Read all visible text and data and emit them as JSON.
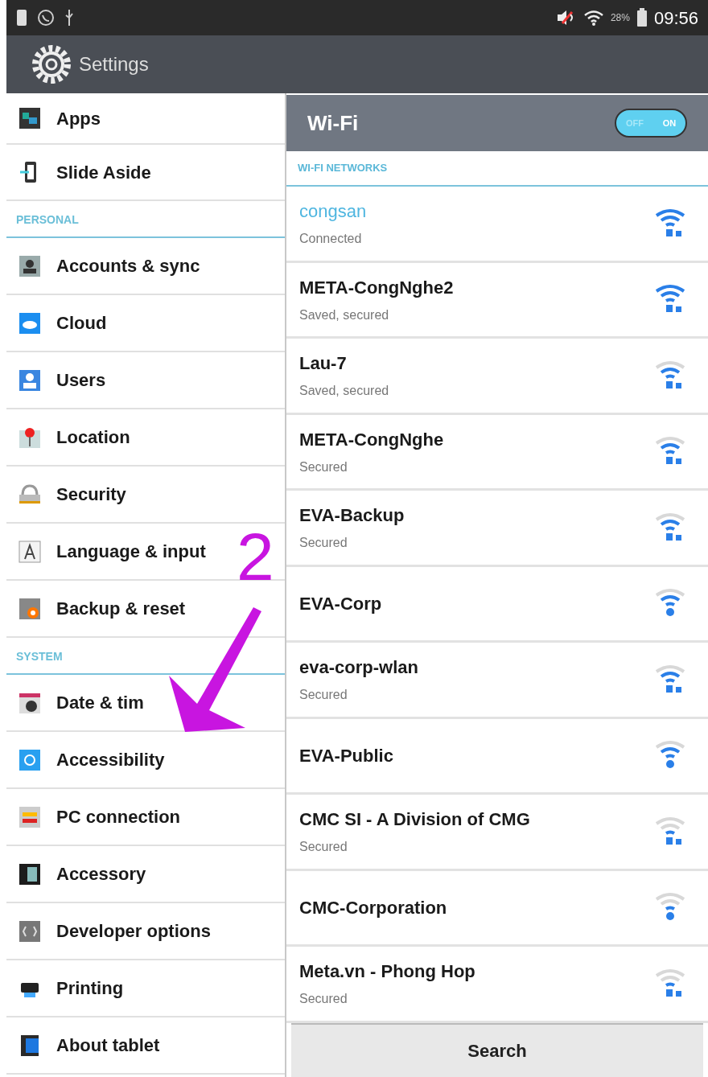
{
  "status_bar": {
    "battery_percent": "28%",
    "time": "09:56"
  },
  "action_bar": {
    "title": "Settings"
  },
  "sidebar": {
    "items": [
      {
        "kind": "item",
        "label": "Apps"
      },
      {
        "kind": "item",
        "label": "Slide Aside"
      },
      {
        "kind": "header",
        "label": "PERSONAL"
      },
      {
        "kind": "item",
        "label": "Accounts & sync"
      },
      {
        "kind": "item",
        "label": "Cloud"
      },
      {
        "kind": "item",
        "label": "Users"
      },
      {
        "kind": "item",
        "label": "Location"
      },
      {
        "kind": "item",
        "label": "Security"
      },
      {
        "kind": "item",
        "label": "Language & input"
      },
      {
        "kind": "item",
        "label": "Backup & reset"
      },
      {
        "kind": "header",
        "label": "SYSTEM"
      },
      {
        "kind": "item",
        "label": "Date & tim"
      },
      {
        "kind": "item",
        "label": "Accessibility"
      },
      {
        "kind": "item",
        "label": "PC connection"
      },
      {
        "kind": "item",
        "label": "Accessory"
      },
      {
        "kind": "item",
        "label": "Developer options"
      },
      {
        "kind": "item",
        "label": "Printing"
      },
      {
        "kind": "item",
        "label": "About tablet"
      }
    ]
  },
  "wifi": {
    "title": "Wi-Fi",
    "toggle": {
      "off_label": "OFF",
      "on_label": "ON",
      "on": true
    },
    "section": "WI-FI NETWORKS",
    "networks": [
      {
        "name": "congsan",
        "status": "Connected",
        "selected": true,
        "kind": "strong",
        "secured": true
      },
      {
        "name": "META-CongNghe2",
        "status": "Saved, secured",
        "selected": false,
        "kind": "strong",
        "secured": true
      },
      {
        "name": "Lau-7",
        "status": "Saved, secured",
        "selected": false,
        "kind": "medium",
        "secured": true
      },
      {
        "name": "META-CongNghe",
        "status": "Secured",
        "selected": false,
        "kind": "medium",
        "secured": true
      },
      {
        "name": "EVA-Backup",
        "status": "Secured",
        "selected": false,
        "kind": "medium",
        "secured": true
      },
      {
        "name": "EVA-Corp",
        "selected": false,
        "kind": "medium",
        "secured": false
      },
      {
        "name": "eva-corp-wlan",
        "status": "Secured",
        "selected": false,
        "kind": "medium",
        "secured": true
      },
      {
        "name": "EVA-Public",
        "selected": false,
        "kind": "medium",
        "secured": false
      },
      {
        "name": "CMC SI - A Division of CMG",
        "status": "Secured",
        "selected": false,
        "kind": "weak",
        "secured": true
      },
      {
        "name": "CMC-Corporation",
        "selected": false,
        "kind": "weak",
        "secured": false
      },
      {
        "name": "Meta.vn - Phong Hop",
        "status": "Secured",
        "selected": false,
        "kind": "weak",
        "secured": true
      }
    ],
    "search_button": "Search"
  },
  "annotation": {
    "label": "2"
  }
}
